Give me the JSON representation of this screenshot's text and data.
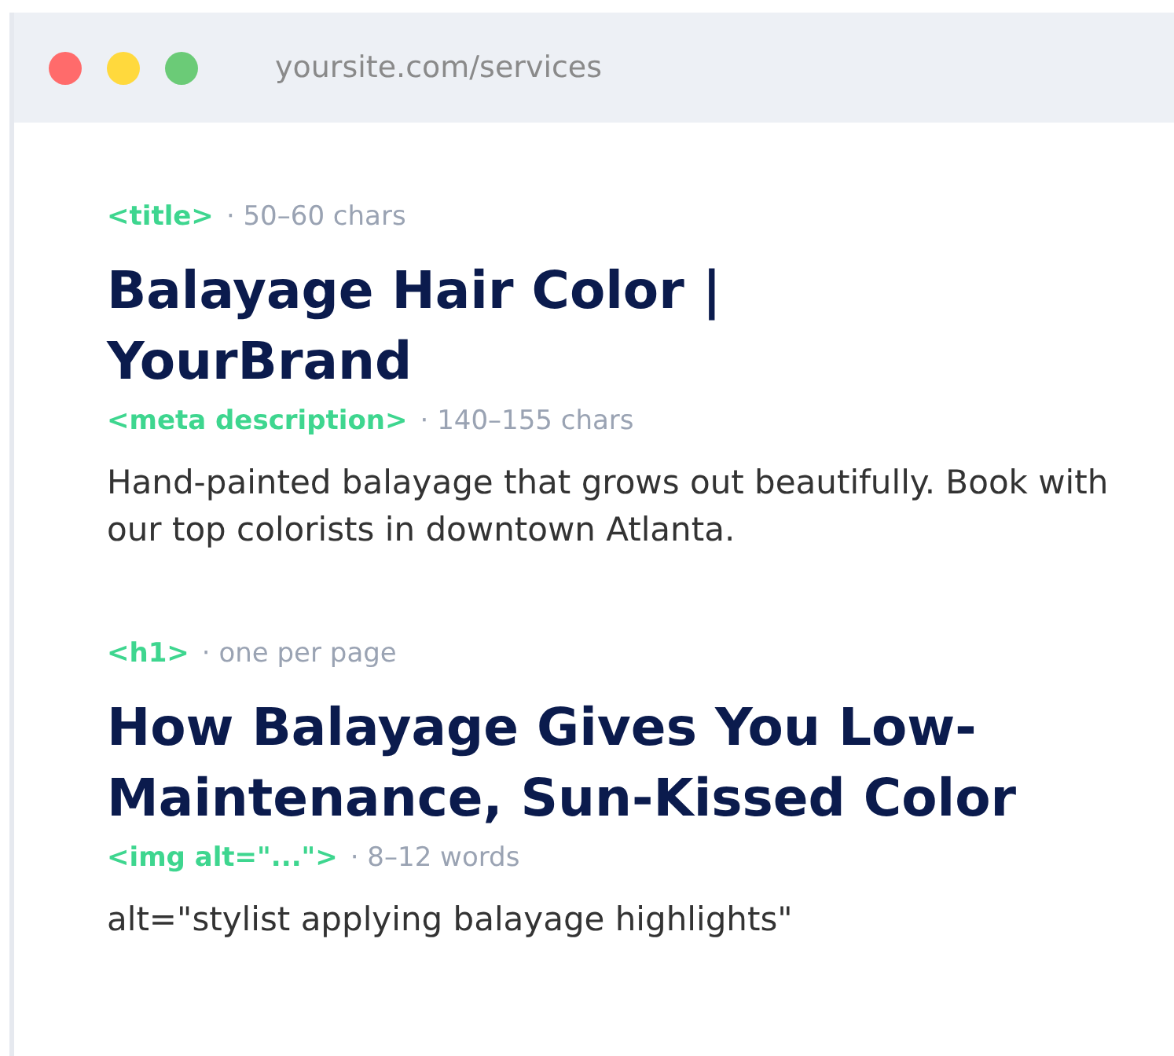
{
  "browser": {
    "url": "yoursite.com/services"
  },
  "sections": [
    {
      "tag": "<title>",
      "note": "· 50–60 chars",
      "kind": "heading",
      "content": "Balayage Hair Color | YourBrand"
    },
    {
      "tag": "<meta description>",
      "note": "· 140–155 chars",
      "kind": "text",
      "content": "Hand-painted balayage that grows out beautifully. Book with our top colorists in downtown Atlanta."
    },
    {
      "tag": "<h1>",
      "note": "· one per page",
      "kind": "heading",
      "content": "How Balayage Gives You Low-Maintenance, Sun-Kissed Color"
    },
    {
      "tag": "<img alt=\"...\">",
      "note": "· 8–12 words",
      "kind": "text",
      "content": "alt=\"stylist applying balayage highlights\""
    }
  ]
}
